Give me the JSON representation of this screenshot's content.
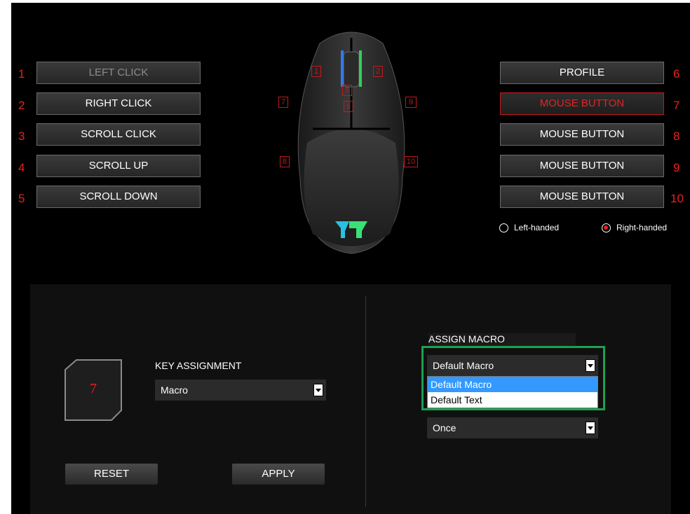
{
  "left_buttons": [
    {
      "num": "1",
      "label": "LEFT CLICK"
    },
    {
      "num": "2",
      "label": "RIGHT CLICK"
    },
    {
      "num": "3",
      "label": "SCROLL CLICK"
    },
    {
      "num": "4",
      "label": "SCROLL UP"
    },
    {
      "num": "5",
      "label": "SCROLL DOWN"
    }
  ],
  "right_buttons": [
    {
      "num": "6",
      "label": "PROFILE"
    },
    {
      "num": "7",
      "label": "MOUSE BUTTON"
    },
    {
      "num": "8",
      "label": "MOUSE BUTTON"
    },
    {
      "num": "9",
      "label": "MOUSE BUTTON"
    },
    {
      "num": "10",
      "label": "MOUSE BUTTON"
    }
  ],
  "mouse_markers": [
    "1",
    "2",
    "5",
    "6",
    "7",
    "8",
    "9",
    "10"
  ],
  "handedness": {
    "left_label": "Left-handed",
    "right_label": "Right-handed",
    "selected": "right"
  },
  "key_panel": {
    "selected_key": "7",
    "assignment_label": "KEY ASSIGNMENT",
    "assignment_value": "Macro",
    "reset_label": "RESET",
    "apply_label": "APPLY"
  },
  "macro_panel": {
    "assign_label": "ASSIGN MACRO",
    "macro_value": "Default Macro",
    "macro_options": [
      "Default Macro",
      "Default Text"
    ],
    "repeat_value": "Once"
  },
  "colors": {
    "accent_red": "#e8211f",
    "highlight_green": "#1aa152",
    "selection_blue": "#3399ff"
  }
}
